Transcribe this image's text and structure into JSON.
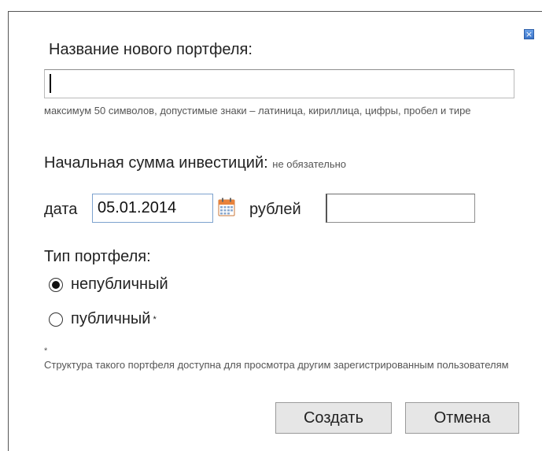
{
  "dialog": {
    "close_label": "×",
    "title": "Название нового портфеля:",
    "name_input": {
      "value": "",
      "placeholder": ""
    },
    "name_hint": "максимум 50 символов, допустимые знаки – латиница, кириллица, цифры, пробел и тире",
    "investment": {
      "label": "Начальная сумма инвестиций:",
      "optional": "не обязательно",
      "date_label": "дата",
      "date_value": "05.01.2014",
      "rubles_label": "рублей",
      "rubles_value": ""
    },
    "type": {
      "label": "Тип портфеля:",
      "options": [
        {
          "label": "непубличный",
          "selected": true
        },
        {
          "label": "публичный",
          "selected": false,
          "marker": "*"
        }
      ]
    },
    "footnote_marker": "*",
    "footnote": "Структура такого портфеля доступна для просмотра другим зарегистрированным пользователям",
    "buttons": {
      "create": "Создать",
      "cancel": "Отмена"
    },
    "colors": {
      "close_button": "#3a74c9",
      "date_border": "#7da2ce",
      "button_bg": "#e6e6e6"
    }
  }
}
